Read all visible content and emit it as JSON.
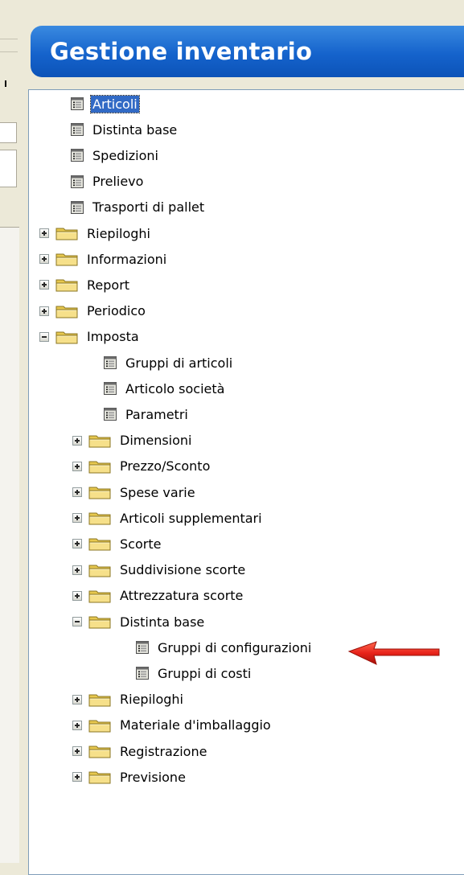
{
  "header": {
    "title": "Gestione inventario"
  },
  "tree": [
    {
      "label": "Articoli",
      "kind": "doc",
      "level": 0,
      "selected": true
    },
    {
      "label": "Distinta base",
      "kind": "doc",
      "level": 0
    },
    {
      "label": "Spedizioni",
      "kind": "doc",
      "level": 0
    },
    {
      "label": "Prelievo",
      "kind": "doc",
      "level": 0
    },
    {
      "label": "Trasporti di pallet",
      "kind": "doc",
      "level": 0
    },
    {
      "label": "Riepiloghi",
      "kind": "folder",
      "level": 0,
      "expanded": false
    },
    {
      "label": "Informazioni",
      "kind": "folder",
      "level": 0,
      "expanded": false
    },
    {
      "label": "Report",
      "kind": "folder",
      "level": 0,
      "expanded": false
    },
    {
      "label": "Periodico",
      "kind": "folder",
      "level": 0,
      "expanded": false
    },
    {
      "label": "Imposta",
      "kind": "folder",
      "level": 0,
      "expanded": true
    },
    {
      "label": "Gruppi di articoli",
      "kind": "doc",
      "level": 1
    },
    {
      "label": "Articolo società",
      "kind": "doc",
      "level": 1
    },
    {
      "label": "Parametri",
      "kind": "doc",
      "level": 1
    },
    {
      "label": "Dimensioni",
      "kind": "folder",
      "level": 1,
      "expanded": false
    },
    {
      "label": "Prezzo/Sconto",
      "kind": "folder",
      "level": 1,
      "expanded": false
    },
    {
      "label": "Spese varie",
      "kind": "folder",
      "level": 1,
      "expanded": false
    },
    {
      "label": "Articoli supplementari",
      "kind": "folder",
      "level": 1,
      "expanded": false
    },
    {
      "label": "Scorte",
      "kind": "folder",
      "level": 1,
      "expanded": false
    },
    {
      "label": "Suddivisione scorte",
      "kind": "folder",
      "level": 1,
      "expanded": false
    },
    {
      "label": "Attrezzatura scorte",
      "kind": "folder",
      "level": 1,
      "expanded": false
    },
    {
      "label": "Distinta base",
      "kind": "folder",
      "level": 1,
      "expanded": true
    },
    {
      "label": "Gruppi di configurazioni",
      "kind": "doc",
      "level": 2
    },
    {
      "label": "Gruppi di costi",
      "kind": "doc",
      "level": 2
    },
    {
      "label": "Riepiloghi",
      "kind": "folder",
      "level": 1,
      "expanded": false
    },
    {
      "label": "Materiale d'imballaggio",
      "kind": "folder",
      "level": 1,
      "expanded": false
    },
    {
      "label": "Registrazione",
      "kind": "folder",
      "level": 1,
      "expanded": false
    },
    {
      "label": "Previsione",
      "kind": "folder",
      "level": 1,
      "expanded": false
    }
  ],
  "icons": {
    "folder": "folder-icon",
    "doc": "form-document-icon",
    "expand": "expand-plus-icon",
    "collapse": "collapse-minus-icon",
    "arrow": "red-arrow-icon"
  },
  "colors": {
    "header_blue": "#1563cc",
    "selection": "#316ac5",
    "arrow_red": "#e8231a",
    "folder_yellow": "#f4dc7a"
  }
}
